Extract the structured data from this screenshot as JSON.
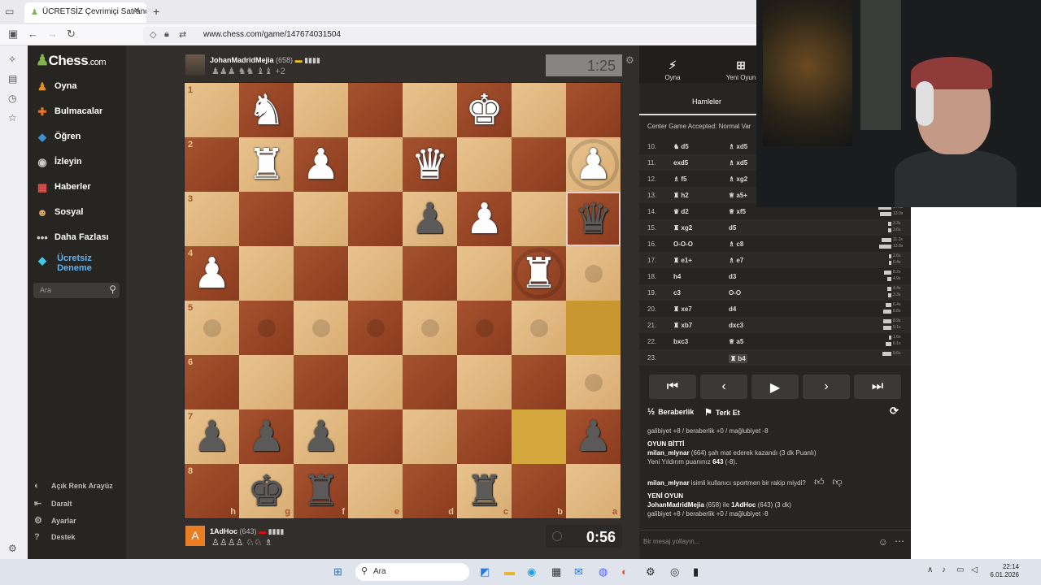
{
  "browser": {
    "tab_title": "ÜCRETSİZ Çevrimiçi Satranç",
    "url": "www.chess.com/game/147674031504"
  },
  "nav": {
    "logo": "Chess",
    "logo_suffix": ".com",
    "items": [
      {
        "label": "Oyna",
        "icon": "play-icon"
      },
      {
        "label": "Bulmacalar",
        "icon": "puzzle-icon"
      },
      {
        "label": "Öğren",
        "icon": "learn-icon"
      },
      {
        "label": "İzleyin",
        "icon": "watch-icon"
      },
      {
        "label": "Haberler",
        "icon": "news-icon"
      },
      {
        "label": "Sosyal",
        "icon": "social-icon"
      },
      {
        "label": "Daha Fazlası",
        "icon": "more-icon"
      }
    ],
    "premium_line1": "Ücretsiz",
    "premium_line2": "Deneme",
    "search_placeholder": "Ara",
    "bottom": [
      {
        "label": "Açık Renk Arayüz",
        "icon": "theme-icon"
      },
      {
        "label": "Daralt",
        "icon": "collapse-icon"
      },
      {
        "label": "Ayarlar",
        "icon": "settings-icon"
      },
      {
        "label": "Destek",
        "icon": "help-icon"
      }
    ]
  },
  "top_player": {
    "name": "JohanMadridMejia",
    "rating": "(658)",
    "captured": "♟♟♟ ♞♞ ♝♝",
    "adv": "+2",
    "clock": "1:25"
  },
  "bottom_player": {
    "avatar_letter": "A",
    "name": "1AdHoc",
    "rating": "(643)",
    "captured": "♙♙♙♙ ♘♘ ♗",
    "clock": "0:56"
  },
  "board": {
    "ranks": [
      "1",
      "2",
      "3",
      "4",
      "5",
      "6",
      "7",
      "8"
    ],
    "files": [
      "h",
      "g",
      "f",
      "e",
      "d",
      "c",
      "b",
      "a"
    ]
  },
  "panel": {
    "tab_play": "Oyna",
    "tab_new": "Yeni Oyun",
    "subtab": "Hamleler",
    "opening": "Center Game Accepted: Normal Var",
    "moves": [
      {
        "n": "10.",
        "w": "♞ d5",
        "b": "♗ xd5",
        "t1": "",
        "t2": ""
      },
      {
        "n": "11.",
        "w": "exd5",
        "b": "♗ xd5",
        "t1": "",
        "t2": ""
      },
      {
        "n": "12.",
        "w": "♗ f5",
        "b": "♗ xg2",
        "t1": "",
        "t2": ""
      },
      {
        "n": "13.",
        "w": "♜ h2",
        "b": "♕ a5+",
        "t1": "",
        "t2": ""
      },
      {
        "n": "14.",
        "w": "♛ d2",
        "b": "♕ xf5",
        "t1": "14.6s",
        "t2": "13.0s"
      },
      {
        "n": "15.",
        "w": "♜ xg2",
        "b": "d5",
        "t1": "3.3s",
        "t2": "3.6s"
      },
      {
        "n": "16.",
        "w": "O-O-O",
        "b": "♗ c8",
        "t1": "11.2s",
        "t2": "13.8s"
      },
      {
        "n": "17.",
        "w": "♜ e1+",
        "b": "♗ e7",
        "t1": "2.6s",
        "t2": "0.4s"
      },
      {
        "n": "18.",
        "w": "h4",
        "b": "d3",
        "t1": "8.2s",
        "t2": "4.9s"
      },
      {
        "n": "19.",
        "w": "c3",
        "b": "O-O",
        "t1": "4.4s",
        "t2": "3.3s"
      },
      {
        "n": "20.",
        "w": "♜ xe7",
        "b": "d4",
        "t1": "6.4s",
        "t2": "8.8s"
      },
      {
        "n": "21.",
        "w": "♜ xb7",
        "b": "dxc3",
        "t1": "8.9s",
        "t2": "9.1s"
      },
      {
        "n": "22.",
        "w": "bxc3",
        "b": "♕ a5",
        "t1": "1.6s",
        "t2": "6.1s"
      },
      {
        "n": "23.",
        "w": "",
        "b": "♜ b4",
        "t1": "9.6s",
        "t2": ""
      }
    ],
    "draw": "Beraberlik",
    "resign": "Terk Et",
    "chat": {
      "l1": "galibiyet +8 / beraberlik +0 / mağlubiyet -8",
      "l2": "OYUN BİTTİ",
      "l3a": "milan_mlynar",
      "l3b": " (664) şah mat ederek kazandı (3 dk Puanlı)",
      "l4a": "Yeni Yıldırım puanınız ",
      "l4b": "643",
      "l4c": " (-8).",
      "l5a": "milan_mlynar",
      "l5b": " isimli kullanıcı sportmen bir rakip miydi?",
      "l6": "YENİ OYUN",
      "l7a": "JohanMadridMejia",
      "l7b": " (658) ile ",
      "l7c": "1AdHoc",
      "l7d": " (643) (3 dk)",
      "l8": "galibiyet +8 / beraberlik +0 / mağlubiyet -8"
    },
    "chat_placeholder": "Bir mesaj yollayın..."
  },
  "taskbar": {
    "search": "Ara",
    "time": "22:14",
    "date": "6.01.2026"
  },
  "colors": {
    "accent": "#81b64c",
    "light_square": "#e8c28e",
    "dark_square": "#a5522e"
  }
}
